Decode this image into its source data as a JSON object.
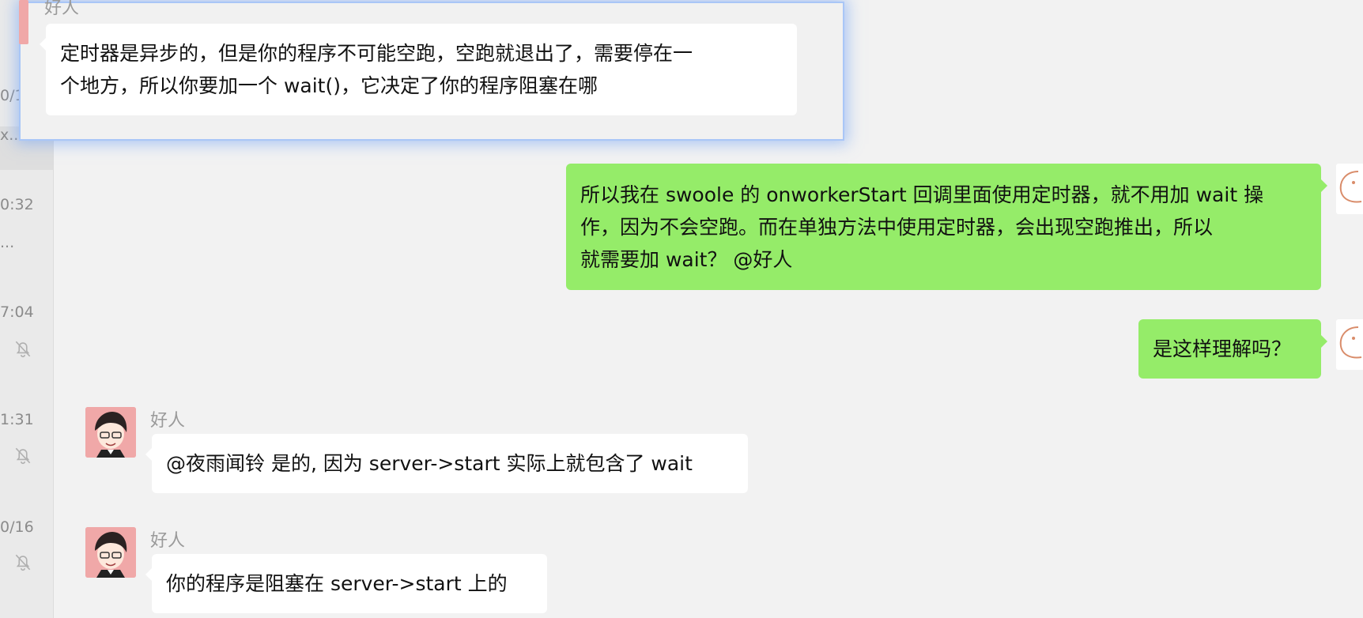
{
  "sidebar": {
    "items": [
      {
        "time": "0/1",
        "snippet": "x..."
      },
      {
        "time": "0:32",
        "snippet": "..."
      },
      {
        "time": "7:04",
        "muted": true
      },
      {
        "time": "1:31",
        "muted": true
      },
      {
        "time": "0/16",
        "muted": true
      }
    ]
  },
  "quote": {
    "sender": "好人",
    "lines": [
      "定时器是异步的，但是你的程序不可能空跑，空跑就退出了，需要停在一",
      "个地方，所以你要加一个 wait()，它决定了你的程序阻塞在哪"
    ]
  },
  "messages": {
    "m1": {
      "lines": [
        "所以我在 swoole 的 onworkerStart 回调里面使用定时器，就不用加 wait 操",
        "作，因为不会空跑。而在单独方法中使用定时器，会出现空跑推出，所以",
        "就需要加 wait？ @好人"
      ]
    },
    "m2": {
      "text": "是这样理解吗？"
    },
    "m3": {
      "sender": "好人",
      "text": "@夜雨闻铃 是的, 因为 server->start 实际上就包含了 wait"
    },
    "m4": {
      "sender": "好人",
      "text": "你的程序是阻塞在 server->start 上的"
    }
  },
  "colors": {
    "outgoing_bubble": "#95ec69",
    "incoming_bubble": "#ffffff",
    "background": "#f2f2f2",
    "highlight": "#a9c6f7"
  }
}
